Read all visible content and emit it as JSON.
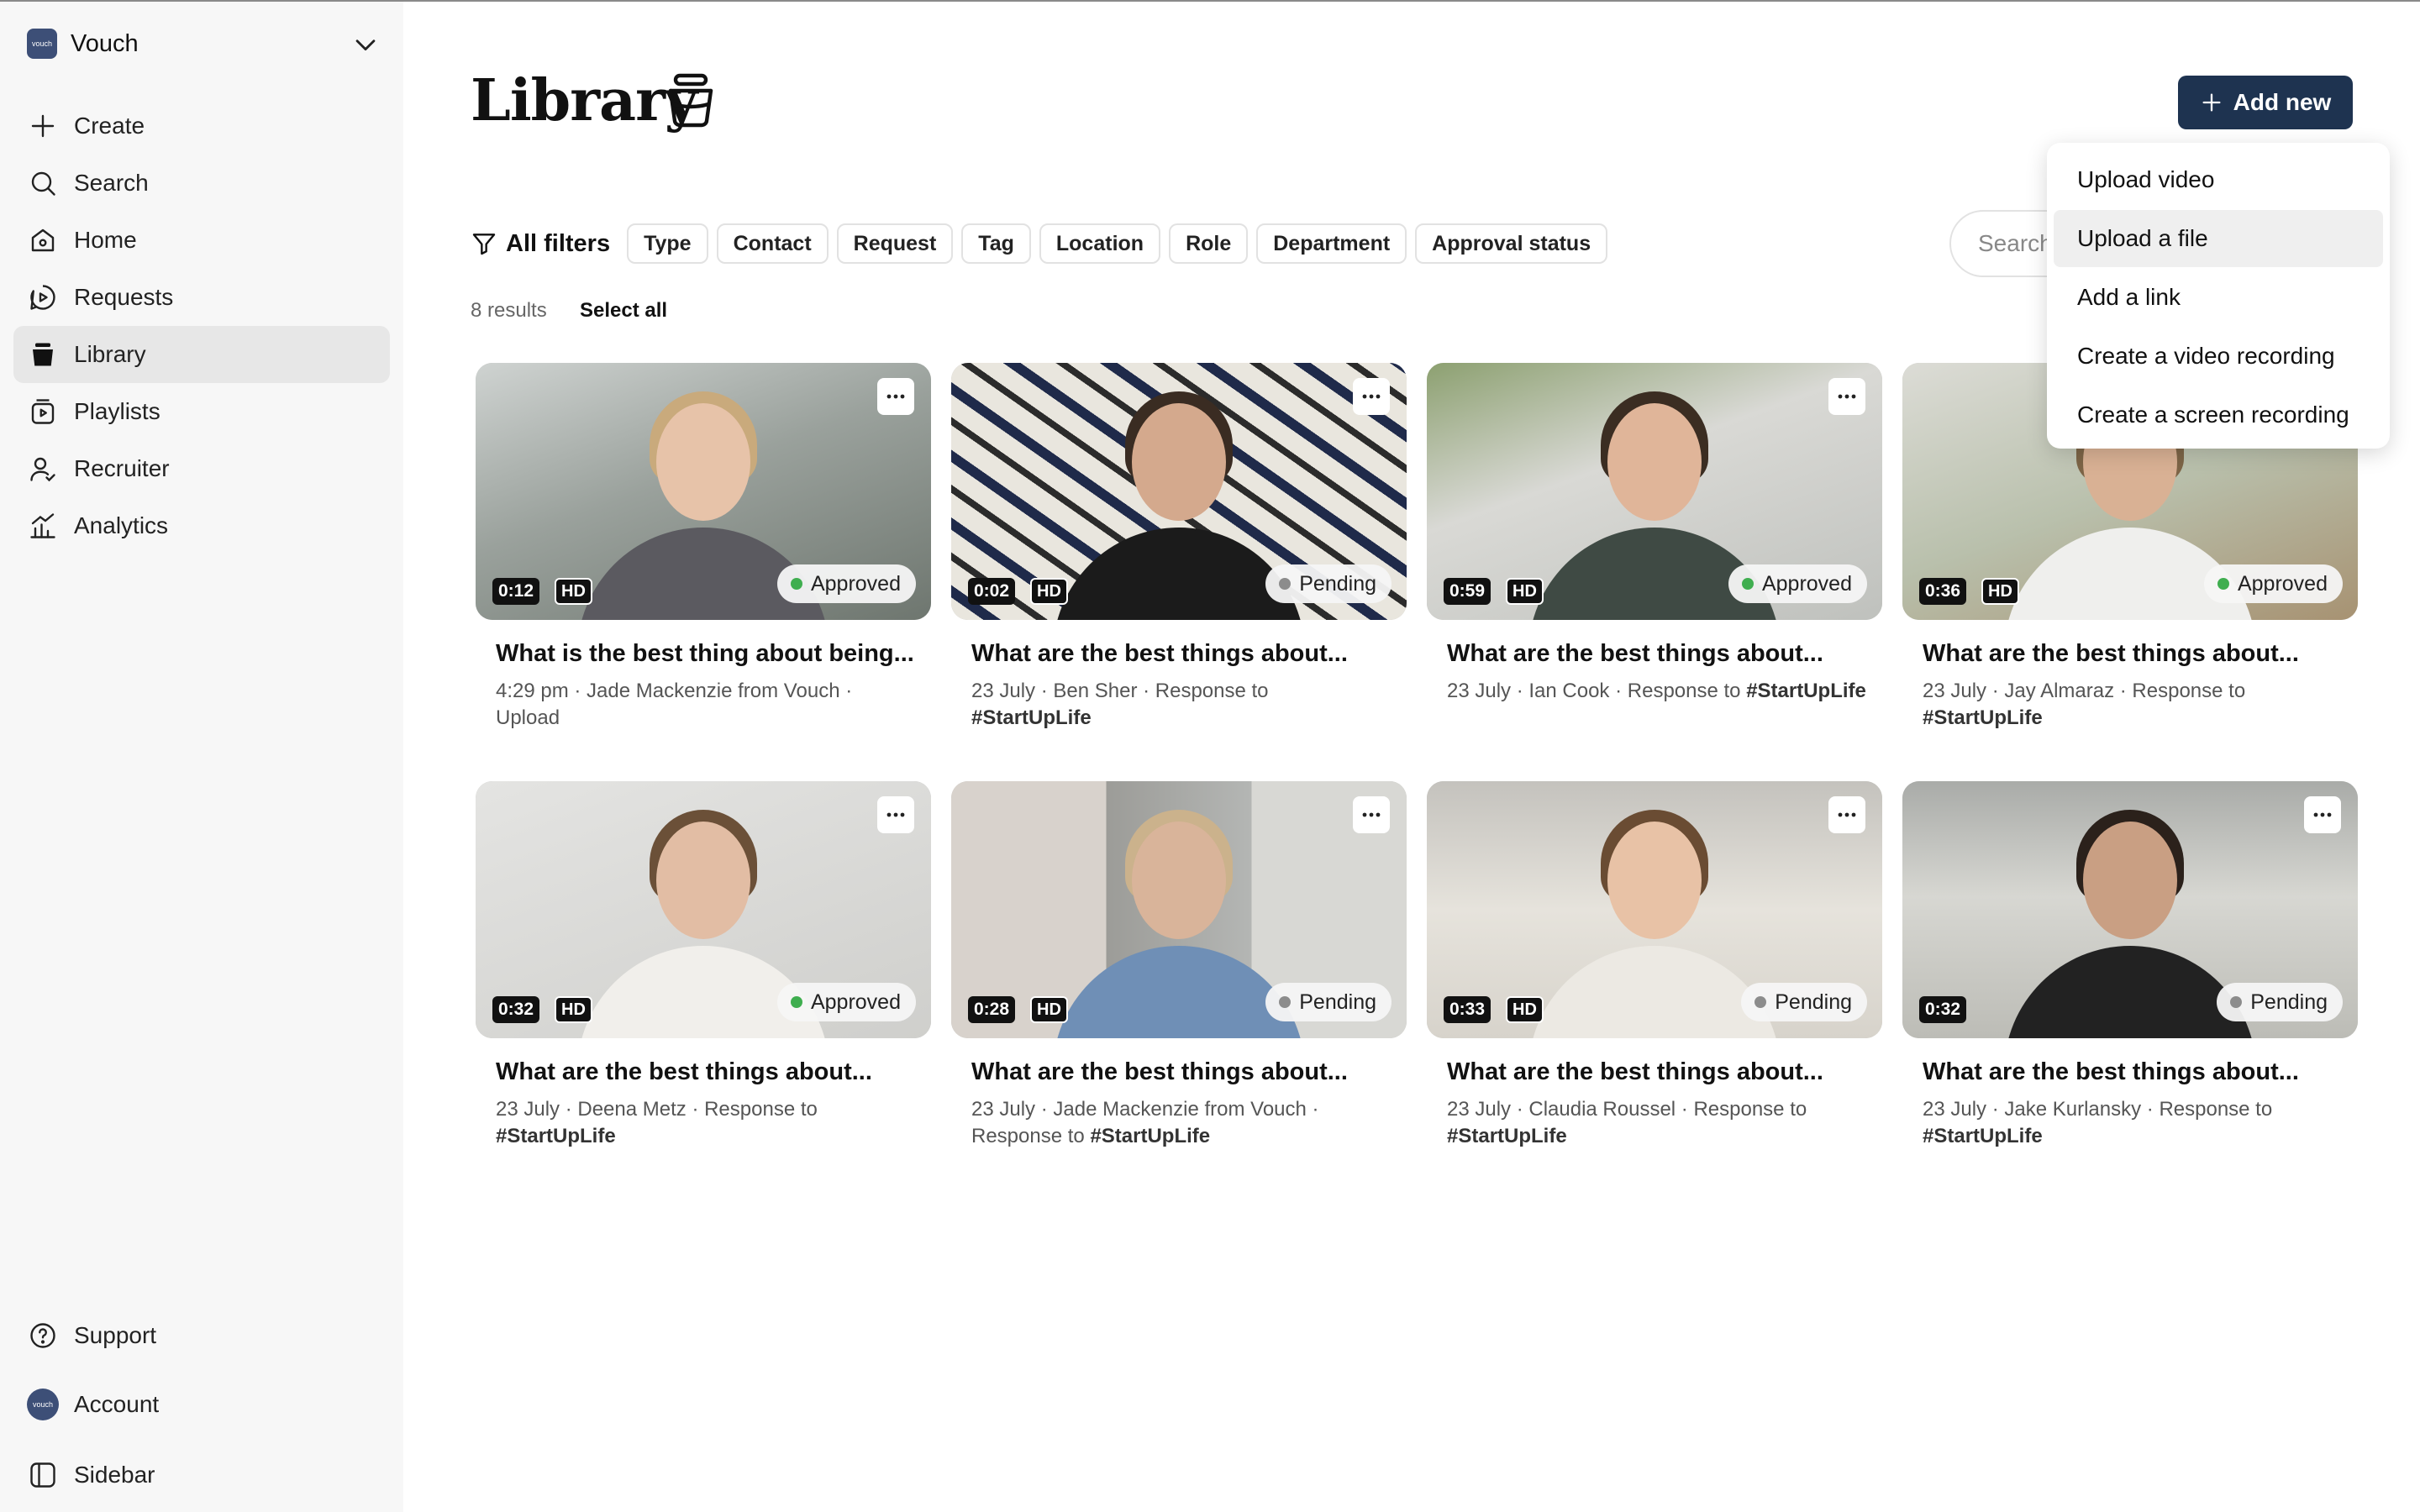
{
  "workspace": {
    "logo_text": "vouch",
    "name": "Vouch"
  },
  "sidebar": {
    "items": [
      {
        "label": "Create",
        "icon": "plus-icon"
      },
      {
        "label": "Search",
        "icon": "search-icon"
      },
      {
        "label": "Home",
        "icon": "home-icon"
      },
      {
        "label": "Requests",
        "icon": "requests-icon"
      },
      {
        "label": "Library",
        "icon": "library-icon",
        "active": true
      },
      {
        "label": "Playlists",
        "icon": "playlists-icon"
      },
      {
        "label": "Recruiter",
        "icon": "recruiter-icon"
      },
      {
        "label": "Analytics",
        "icon": "analytics-icon"
      }
    ],
    "footer": [
      {
        "label": "Support",
        "icon": "help-icon"
      },
      {
        "label": "Account",
        "icon": "account-avatar"
      },
      {
        "label": "Sidebar",
        "icon": "sidebar-toggle-icon"
      }
    ]
  },
  "page": {
    "title": "Library"
  },
  "add_button": {
    "label": "Add new"
  },
  "filters": {
    "all_label": "All filters",
    "chips": [
      "Type",
      "Contact",
      "Request",
      "Tag",
      "Location",
      "Role",
      "Department",
      "Approval status"
    ]
  },
  "search": {
    "placeholder": "Search"
  },
  "results": {
    "count_label": "8 results",
    "select_all": "Select all"
  },
  "menu": {
    "items": [
      "Upload video",
      "Upload a file",
      "Add a link",
      "Create a video recording",
      "Create a screen recording"
    ],
    "highlighted": "Upload a file"
  },
  "status_colors": {
    "Approved": "#3fae4f",
    "Pending": "#8c8c8c"
  },
  "videos": [
    {
      "duration": "0:12",
      "hd": "HD",
      "status": "Approved",
      "title": "What is the best thing about being...",
      "meta": "4:29 pm · Jade Mackenzie from Vouch · Upload",
      "tag": ""
    },
    {
      "duration": "0:02",
      "hd": "HD",
      "status": "Pending",
      "title": "What are the best things about...",
      "meta": "23 July · Ben Sher · Response to",
      "tag": "#StartUpLife"
    },
    {
      "duration": "0:59",
      "hd": "HD",
      "status": "Approved",
      "title": "What are the best things about...",
      "meta": "23 July · Ian Cook · Response to",
      "tag": "#StartUpLife"
    },
    {
      "duration": "0:36",
      "hd": "HD",
      "status": "Approved",
      "title": "What are the best things about...",
      "meta": "23 July · Jay Almaraz · Response to",
      "tag": "#StartUpLife"
    },
    {
      "duration": "0:32",
      "hd": "HD",
      "status": "Approved",
      "title": "What are the best things about...",
      "meta": "23 July · Deena Metz · Response to",
      "tag": "#StartUpLife"
    },
    {
      "duration": "0:28",
      "hd": "HD",
      "status": "Pending",
      "title": "What are the best things about...",
      "meta": "23 July · Jade Mackenzie from Vouch · Response to",
      "tag": "#StartUpLife"
    },
    {
      "duration": "0:33",
      "hd": "HD",
      "status": "Pending",
      "title": "What are the best things about...",
      "meta": "23 July · Claudia Roussel · Response to",
      "tag": "#StartUpLife"
    },
    {
      "duration": "0:32",
      "hd": "",
      "status": "Pending",
      "title": "What are the best things about...",
      "meta": "23 July · Jake Kurlansky · Response to",
      "tag": "#StartUpLife"
    }
  ]
}
